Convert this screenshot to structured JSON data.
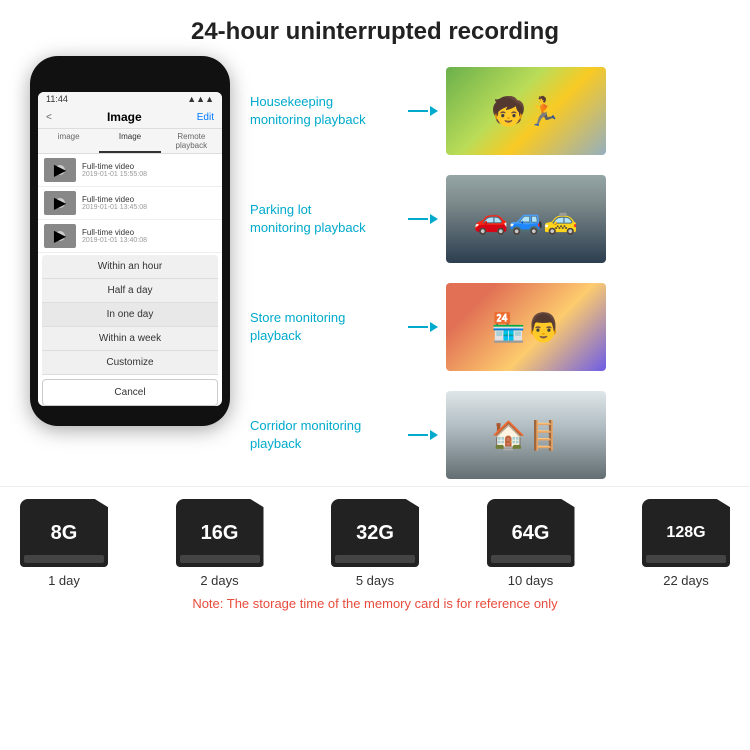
{
  "header": {
    "title": "24-hour uninterrupted recording"
  },
  "phone": {
    "time": "11:44",
    "top_bar": {
      "back": "<",
      "title": "Image",
      "edit": "Edit"
    },
    "tabs": [
      "image",
      "Image",
      "Remote playback"
    ],
    "list_items": [
      {
        "title": "Full-time video",
        "date": "2019-01-01 15:55:08"
      },
      {
        "title": "Full-time video",
        "date": "2019-01-01 13:45:08"
      },
      {
        "title": "Full-time video",
        "date": "2019-01-01 13:40:08"
      }
    ],
    "dropdown": {
      "items": [
        "Within an hour",
        "Half a day",
        "In one day",
        "Within a week",
        "Customize"
      ],
      "active_index": 2,
      "cancel": "Cancel"
    }
  },
  "monitoring": [
    {
      "label": "Housekeeping\nmonitoring playback",
      "photo_type": "housekeeping",
      "emoji": "🧒"
    },
    {
      "label": "Parking lot\nmonitoring playback",
      "photo_type": "parking",
      "emoji": "🚗"
    },
    {
      "label": "Store monitoring\nplayback",
      "photo_type": "store",
      "emoji": "🏪"
    },
    {
      "label": "Corridor monitoring\nplayback",
      "photo_type": "corridor",
      "emoji": "🏠"
    }
  ],
  "storage": {
    "cards": [
      {
        "size": "8G",
        "days": "1 day"
      },
      {
        "size": "16G",
        "days": "2 days"
      },
      {
        "size": "32G",
        "days": "5 days"
      },
      {
        "size": "64G",
        "days": "10 days"
      },
      {
        "size": "128G",
        "days": "22 days"
      }
    ],
    "note": "Note: The storage time of the memory card is for reference only"
  }
}
